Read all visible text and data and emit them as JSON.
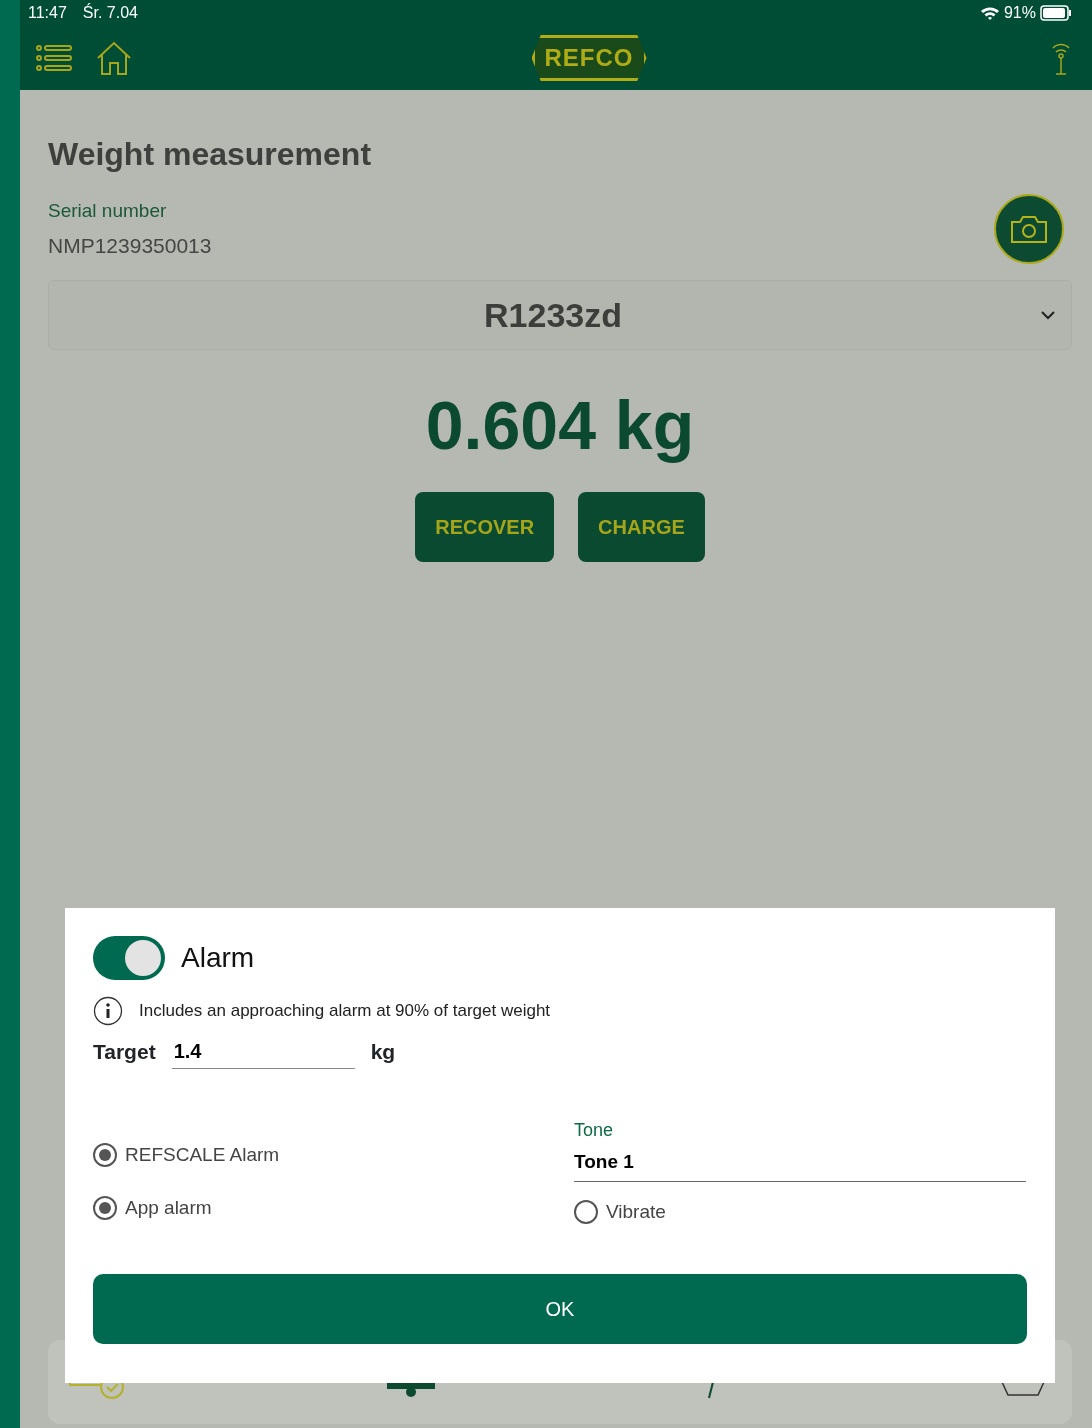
{
  "status_bar": {
    "time": "11:47",
    "date": "Śr. 7.04",
    "battery": "91%"
  },
  "header": {
    "logo": "REFCO"
  },
  "page": {
    "title": "Weight measurement",
    "serial_label": "Serial number",
    "serial_value": "NMP1239350013",
    "refrigerant": "R1233zd",
    "weight": "0.604 kg",
    "buttons": [
      "RECOVER",
      "CHARGE"
    ]
  },
  "dialog": {
    "alarm_label": "Alarm",
    "alarm_on": true,
    "info": "Includes an approaching alarm at 90% of target weight",
    "target_label": "Target",
    "target_value": "1.4",
    "target_unit": "kg",
    "options": [
      {
        "label": "REFSCALE Alarm",
        "checked": true
      },
      {
        "label": "App alarm",
        "checked": true
      }
    ],
    "tone_label": "Tone",
    "tone_value": "Tone 1",
    "vibrate": {
      "label": "Vibrate",
      "checked": false
    },
    "ok": "OK"
  }
}
